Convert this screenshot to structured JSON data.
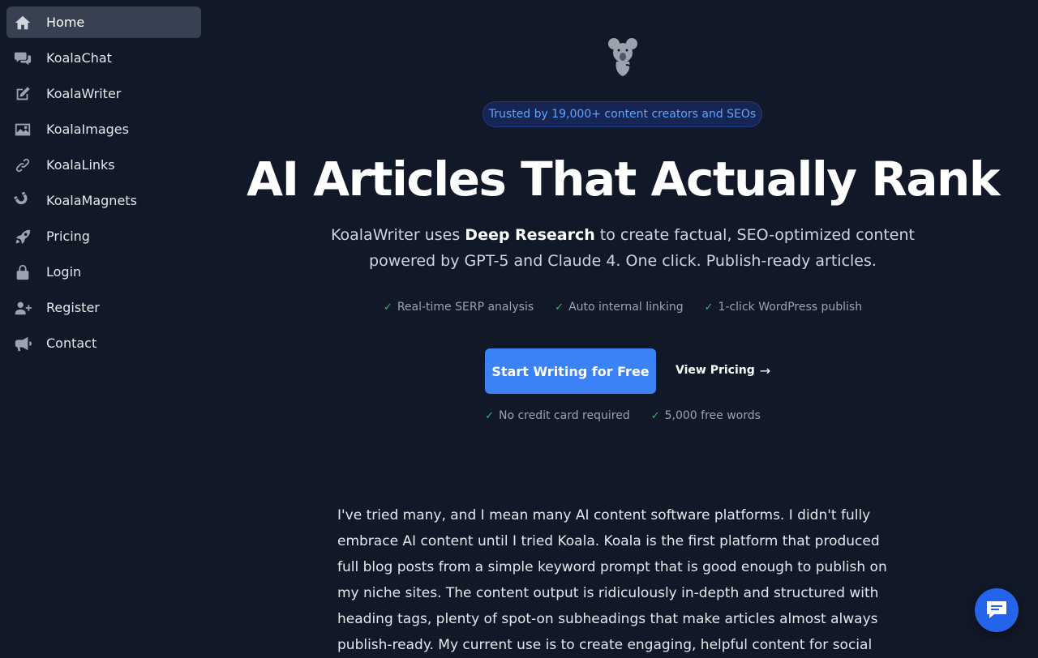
{
  "sidebar": {
    "items": [
      {
        "label": "Home",
        "icon": "home-icon",
        "active": true
      },
      {
        "label": "KoalaChat",
        "icon": "chat-bubbles-icon"
      },
      {
        "label": "KoalaWriter",
        "icon": "pencil-square-icon"
      },
      {
        "label": "KoalaImages",
        "icon": "image-icon"
      },
      {
        "label": "KoalaLinks",
        "icon": "link-icon"
      },
      {
        "label": "KoalaMagnets",
        "icon": "magnet-icon"
      },
      {
        "label": "Pricing",
        "icon": "rocket-icon"
      },
      {
        "label": "Login",
        "icon": "lock-icon"
      },
      {
        "label": "Register",
        "icon": "user-plus-icon"
      },
      {
        "label": "Contact",
        "icon": "megaphone-icon"
      }
    ]
  },
  "hero": {
    "badge": "Trusted by 19,000+ content creators and SEOs",
    "title": "AI Articles That Actually Rank",
    "subtitle_pre": "KoalaWriter uses ",
    "subtitle_bold": "Deep Research",
    "subtitle_post": " to create factual, SEO-optimized content powered by GPT-5 and Claude 4. One click. Publish-ready articles.",
    "features": [
      "Real-time SERP analysis",
      "Auto internal linking",
      "1-click WordPress publish"
    ],
    "cta_primary": "Start Writing for Free",
    "cta_secondary": "View Pricing",
    "reassurances": [
      "No credit card required",
      "5,000 free words"
    ]
  },
  "testimonial": {
    "text": "I've tried many, and I mean many AI content software platforms. I didn't fully embrace AI content until I tried Koala. Koala is the first platform that produced full blog posts from a simple keyword prompt that is good enough to publish on my niche sites. The content output is ridiculously in-depth and structured with heading tags, plenty of spot-on subheadings that make articles almost always publish-ready. My current use is to create engaging, helpful content for social"
  },
  "colors": {
    "background": "#111827",
    "accent": "#3b82f6",
    "check": "#22c55e",
    "badge_text": "#60a5fa"
  }
}
